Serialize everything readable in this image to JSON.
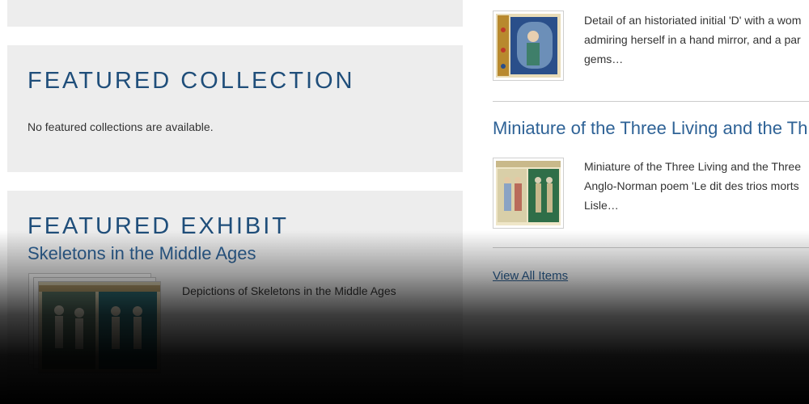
{
  "featured_collection": {
    "heading": "FEATURED COLLECTION",
    "message": "No featured collections are available."
  },
  "featured_exhibit": {
    "heading": "FEATURED EXHIBIT",
    "title": "Skeletons in the Middle Ages",
    "description": "Depictions of Skeletons in the Middle Ages"
  },
  "items": [
    {
      "title": "",
      "description_lines": [
        "Detail of an historiated initial 'D' with a wom",
        "admiring herself in a hand mirror, and a par",
        "gems…"
      ]
    },
    {
      "title": "Miniature of the Three Living and the Th",
      "description_lines": [
        "Miniature of the Three Living and the Three",
        "Anglo-Norman poem 'Le dit des trios morts",
        "Lisle…"
      ]
    }
  ],
  "view_all_label": "View All Items",
  "colors": {
    "heading": "#1f4e7a",
    "link": "#2e6296",
    "panel_bg": "#ededed",
    "text": "#333333"
  }
}
